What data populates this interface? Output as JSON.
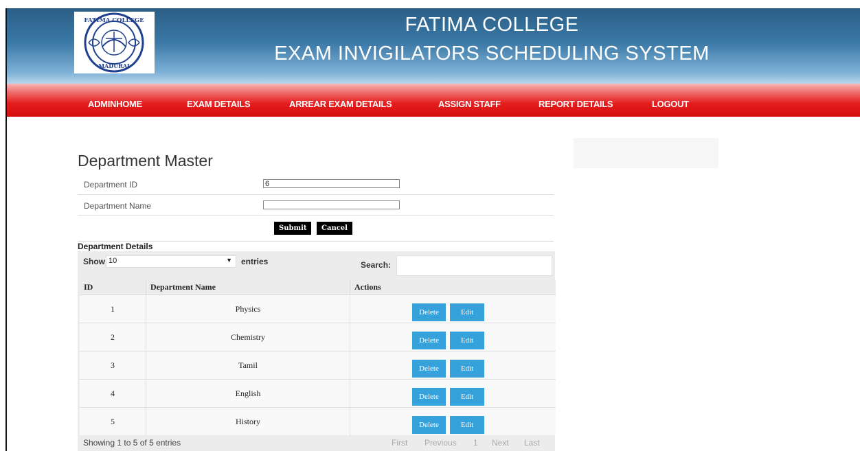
{
  "header": {
    "title_line1": "FATIMA COLLEGE",
    "title_line2": "EXAM INVIGILATORS SCHEDULING SYSTEM",
    "logo": {
      "top_text": "FATIMA COLLEGE",
      "bottom_text": "MADURAI",
      "icon": "college-seal-logo"
    }
  },
  "nav": {
    "items": [
      "ADMINHOME",
      "EXAM DETAILS",
      "ARREAR EXAM DETAILS",
      "ASSIGN STAFF",
      "REPORT DETAILS",
      "LOGOUT"
    ]
  },
  "form": {
    "title": "Department Master",
    "dept_id_label": "Department ID",
    "dept_id_value": "6",
    "dept_name_label": "Department Name",
    "dept_name_value": "",
    "submit_label": "Submit",
    "cancel_label": "Cancel"
  },
  "table": {
    "section_title": "Department Details",
    "show_label": "Show",
    "show_value": "10",
    "entries_label": "entries",
    "search_label": "Search:",
    "search_value": "",
    "columns": [
      "ID",
      "Department Name",
      "Actions"
    ],
    "rows": [
      {
        "id": "1",
        "name": "Physics"
      },
      {
        "id": "2",
        "name": "Chemistry"
      },
      {
        "id": "3",
        "name": "Tamil"
      },
      {
        "id": "4",
        "name": "English"
      },
      {
        "id": "5",
        "name": "History"
      }
    ],
    "delete_label": "Delete",
    "edit_label": "Edit",
    "info": "Showing 1 to 5 of 5 entries",
    "pager": {
      "first": "First",
      "previous": "Previous",
      "page": "1",
      "next": "Next",
      "last": "Last"
    }
  },
  "colors": {
    "header_blue": "#3a78a6",
    "nav_red": "#e41d1d",
    "action_button": "#35a2dc",
    "form_button": "#000000"
  }
}
